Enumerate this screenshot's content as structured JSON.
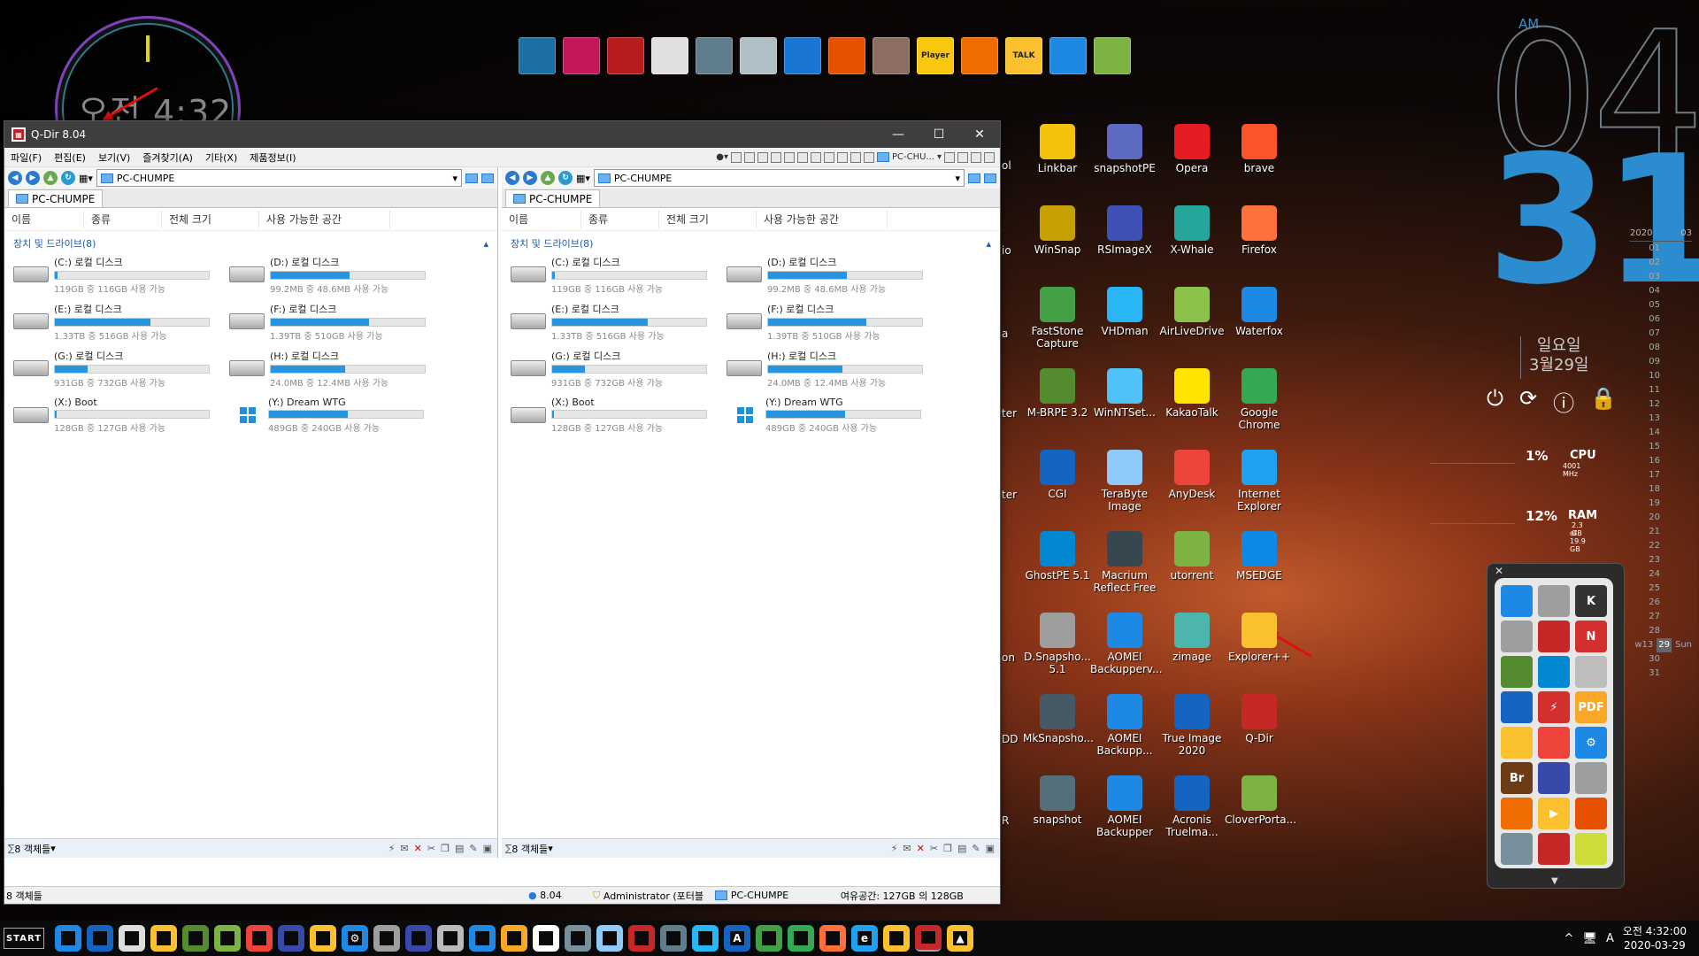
{
  "window": {
    "title": "Q-Dir 8.04",
    "minimize": "—",
    "maximize": "☐",
    "close": "✕"
  },
  "clock_widget": {
    "text": "오전 4:32"
  },
  "menu": [
    "파일(F)",
    "편집(E)",
    "보기(V)",
    "즐겨찾기(A)",
    "기타(X)",
    "제품정보(I)"
  ],
  "toolbar_pc": "PC-CHU...",
  "panes": [
    {
      "address": "PC-CHUMPE",
      "tab": "PC-CHUMPE",
      "columns": [
        "이름",
        "종류",
        "전체 크기",
        "사용 가능한 공간"
      ],
      "group": "장치 및 드라이브(8)",
      "status": "8 객체들",
      "drives": [
        {
          "name": "(C:) 로컬 디스크",
          "free": "119GB 중 116GB 사용 가능",
          "usage": 0.02,
          "win": false
        },
        {
          "name": "(D:) 로컬 디스크",
          "free": "99.2MB 중 48.6MB 사용 가능",
          "usage": 0.51,
          "win": false
        },
        {
          "name": "(E:) 로컬 디스크",
          "free": "1.33TB 중 516GB 사용 가능",
          "usage": 0.62,
          "win": false
        },
        {
          "name": "(F:) 로컬 디스크",
          "free": "1.39TB 중 510GB 사용 가능",
          "usage": 0.64,
          "win": false
        },
        {
          "name": "(G:) 로컬 디스크",
          "free": "931GB 중 732GB 사용 가능",
          "usage": 0.21,
          "win": false
        },
        {
          "name": "(H:) 로컬 디스크",
          "free": "24.0MB 중 12.4MB 사용 가능",
          "usage": 0.48,
          "win": false
        },
        {
          "name": "(X:) Boot",
          "free": "128GB 중 127GB 사용 가능",
          "usage": 0.01,
          "win": false
        },
        {
          "name": "(Y:) Dream WTG",
          "free": "489GB 중 240GB 사용 가능",
          "usage": 0.51,
          "win": true
        }
      ]
    },
    {
      "address": "PC-CHUMPE",
      "tab": "PC-CHUMPE",
      "columns": [
        "이름",
        "종류",
        "전체 크기",
        "사용 가능한 공간"
      ],
      "group": "장치 및 드라이브(8)",
      "status": "8 객체들",
      "drives": [
        {
          "name": "(C:) 로컬 디스크",
          "free": "119GB 중 116GB 사용 가능",
          "usage": 0.02,
          "win": false
        },
        {
          "name": "(D:) 로컬 디스크",
          "free": "99.2MB 중 48.6MB 사용 가능",
          "usage": 0.51,
          "win": false
        },
        {
          "name": "(E:) 로컬 디스크",
          "free": "1.33TB 중 516GB 사용 가능",
          "usage": 0.62,
          "win": false
        },
        {
          "name": "(F:) 로컬 디스크",
          "free": "1.39TB 중 510GB 사용 가능",
          "usage": 0.64,
          "win": false
        },
        {
          "name": "(G:) 로컬 디스크",
          "free": "931GB 중 732GB 사용 가능",
          "usage": 0.21,
          "win": false
        },
        {
          "name": "(H:) 로컬 디스크",
          "free": "24.0MB 중 12.4MB 사용 가능",
          "usage": 0.48,
          "win": false
        },
        {
          "name": "(X:) Boot",
          "free": "128GB 중 127GB 사용 가능",
          "usage": 0.01,
          "win": false
        },
        {
          "name": "(Y:) Dream WTG",
          "free": "489GB 중 240GB 사용 가능",
          "usage": 0.51,
          "win": true
        }
      ]
    }
  ],
  "footer": {
    "left": "8 객체들",
    "version": "8.04",
    "user": "Administrator (포터블",
    "pc": "PC-CHUMPE",
    "space": "여유공간: 127GB 의 128GB"
  },
  "topdock": [
    {
      "label": "",
      "color": "#1d6fa5"
    },
    {
      "label": "",
      "color": "#c2185b"
    },
    {
      "label": "",
      "color": "#b71c1c"
    },
    {
      "label": "",
      "color": "#e0e0e0"
    },
    {
      "label": "",
      "color": "#607d8b"
    },
    {
      "label": "",
      "color": "#b0bec5"
    },
    {
      "label": "",
      "color": "#1976d2"
    },
    {
      "label": "",
      "color": "#e65100"
    },
    {
      "label": "",
      "color": "#8d6e63"
    },
    {
      "label": "Player",
      "color": "#f9c80e"
    },
    {
      "label": "",
      "color": "#ef6c00"
    },
    {
      "label": "TALK",
      "color": "#fbc02d"
    },
    {
      "label": "",
      "color": "#1e88e5"
    },
    {
      "label": "",
      "color": "#7cb342"
    }
  ],
  "bigclock": {
    "ampm": "AM",
    "hour": "04",
    "minute": "31",
    "dow": "일요일",
    "date": "3월29일"
  },
  "power_icons": [
    "⏻",
    "⟳",
    "ⓘ",
    "🔒"
  ],
  "calendar": {
    "year": "2020",
    "month": "03",
    "days": [
      "01",
      "02",
      "03",
      "04",
      "05",
      "06",
      "07",
      "08",
      "09",
      "10",
      "11",
      "12",
      "13",
      "14",
      "15",
      "16",
      "17",
      "18",
      "19",
      "20",
      "21",
      "22",
      "23",
      "24",
      "25",
      "26",
      "27",
      "28"
    ],
    "week": "w13",
    "today": "29",
    "today_label": "Sun",
    "after": [
      "30",
      "31"
    ]
  },
  "cpu": {
    "pct": "1%",
    "label": "CPU",
    "sub": "4001 MHz"
  },
  "ram": {
    "pct": "12%",
    "label": "RAM",
    "sub1": "2.3 GB",
    "sub2": "of 19.9 GB"
  },
  "edge_labels": [
    "ol",
    "io",
    "a",
    "ter",
    "ter",
    "",
    "on",
    "DD",
    "R"
  ],
  "desktop_icons": [
    {
      "label": "Linkbar",
      "color": "#f4c20d"
    },
    {
      "label": "snapshotPE",
      "color": "#5c6bc0"
    },
    {
      "label": "Opera",
      "color": "#e51c23"
    },
    {
      "label": "brave",
      "color": "#fb542b"
    },
    {
      "label": "WinSnap",
      "color": "#c6a000"
    },
    {
      "label": "RSImageX",
      "color": "#3f51b5"
    },
    {
      "label": "X-Whale",
      "color": "#26a69a"
    },
    {
      "label": "Firefox",
      "color": "#ff7139"
    },
    {
      "label": "FastStone Capture",
      "color": "#43a047"
    },
    {
      "label": "VHDman",
      "color": "#29b6f6"
    },
    {
      "label": "AirLiveDrive",
      "color": "#8bc34a"
    },
    {
      "label": "Waterfox",
      "color": "#1e88e5"
    },
    {
      "label": "M-BRPE 3.2",
      "color": "#558b2f"
    },
    {
      "label": "WinNTSet...",
      "color": "#4fc3f7"
    },
    {
      "label": "KakaoTalk",
      "color": "#fee500"
    },
    {
      "label": "Google Chrome",
      "color": "#34a853"
    },
    {
      "label": "CGI",
      "color": "#1565c0"
    },
    {
      "label": "TeraByte Image",
      "color": "#90caf9"
    },
    {
      "label": "AnyDesk",
      "color": "#ef443b"
    },
    {
      "label": "Internet Explorer",
      "color": "#1ea1f1"
    },
    {
      "label": "GhostPE 5.1",
      "color": "#0288d1"
    },
    {
      "label": "Macrium Reflect Free",
      "color": "#37474f"
    },
    {
      "label": "utorrent",
      "color": "#7cb342"
    },
    {
      "label": "MSEDGE",
      "color": "#0c8ae5"
    },
    {
      "label": "D.Snapsho... 5.1",
      "color": "#9e9e9e"
    },
    {
      "label": "AOMEI Backupperv...",
      "color": "#1e88e5"
    },
    {
      "label": "zimage",
      "color": "#4db6ac"
    },
    {
      "label": "Explorer++",
      "color": "#fbc02d"
    },
    {
      "label": "MkSnapsho...",
      "color": "#455a64"
    },
    {
      "label": "AOMEI Backupp...",
      "color": "#1e88e5"
    },
    {
      "label": "True Image 2020",
      "color": "#1565c0"
    },
    {
      "label": "Q-Dir",
      "color": "#c62828"
    },
    {
      "label": "snapshot",
      "color": "#546e7a"
    },
    {
      "label": "AOMEI Backupper",
      "color": "#1e88e5"
    },
    {
      "label": "Acronis Truelma...",
      "color": "#1565c0"
    },
    {
      "label": "CloverPorta...",
      "color": "#7cb342"
    }
  ],
  "side_panel": {
    "close": "✕",
    "icons": [
      {
        "color": "#1e88e5",
        "label": ""
      },
      {
        "color": "#9e9e9e",
        "label": ""
      },
      {
        "color": "#333",
        "label": "K"
      },
      {
        "color": "#9e9e9e",
        "label": ""
      },
      {
        "color": "#c62828",
        "label": ""
      },
      {
        "color": "#d32f2f",
        "label": "N"
      },
      {
        "color": "#558b2f",
        "label": ""
      },
      {
        "color": "#0288d1",
        "label": ""
      },
      {
        "color": "#bdbdbd",
        "label": ""
      },
      {
        "color": "#1565c0",
        "label": ""
      },
      {
        "color": "#d32f2f",
        "label": "⚡"
      },
      {
        "color": "#f9a825",
        "label": "PDF"
      },
      {
        "color": "#fbc02d",
        "label": ""
      },
      {
        "color": "#ef443b",
        "label": ""
      },
      {
        "color": "#1e88e5",
        "label": "⚙"
      },
      {
        "color": "#6d3b16",
        "label": "Br"
      },
      {
        "color": "#3949ab",
        "label": ""
      },
      {
        "color": "#9e9e9e",
        "label": ""
      },
      {
        "color": "#ef6c00",
        "label": ""
      },
      {
        "color": "#fbc02d",
        "label": "▶"
      },
      {
        "color": "#e65100",
        "label": ""
      },
      {
        "color": "#78909c",
        "label": ""
      },
      {
        "color": "#c62828",
        "label": ""
      },
      {
        "color": "#cddc39",
        "label": ""
      }
    ]
  },
  "taskbar": {
    "start": "START",
    "icons": [
      {
        "color": "#1e88e5",
        "label": ""
      },
      {
        "color": "#1565c0",
        "label": ""
      },
      {
        "color": "#ddd",
        "label": ""
      },
      {
        "color": "#fbc02d",
        "label": ""
      },
      {
        "color": "#558b2f",
        "label": ""
      },
      {
        "color": "#7cb342",
        "label": ""
      },
      {
        "color": "#ef443b",
        "label": ""
      },
      {
        "color": "#3949ab",
        "label": ""
      },
      {
        "color": "#fbc02d",
        "label": ""
      },
      {
        "color": "#1e88e5",
        "label": "⚙"
      },
      {
        "color": "#9e9e9e",
        "label": ""
      },
      {
        "color": "#3949ab",
        "label": ""
      },
      {
        "color": "#bbb",
        "label": ""
      },
      {
        "color": "#1e88e5",
        "label": ""
      },
      {
        "color": "#f9a825",
        "label": ""
      },
      {
        "color": "#fff",
        "label": ""
      },
      {
        "color": "#78909c",
        "label": ""
      },
      {
        "color": "#90caf9",
        "label": ""
      },
      {
        "color": "#c62828",
        "label": ""
      },
      {
        "color": "#607d8b",
        "label": ""
      },
      {
        "color": "#29b6f6",
        "label": ""
      },
      {
        "color": "#1565c0",
        "label": "A"
      },
      {
        "color": "#43a047",
        "label": ""
      },
      {
        "color": "#34a853",
        "label": ""
      },
      {
        "color": "#ff7139",
        "label": ""
      },
      {
        "color": "#1ea1f1",
        "label": "e"
      },
      {
        "color": "#fbc02d",
        "label": ""
      },
      {
        "color": "#c62828",
        "label": "",
        "active": true
      },
      {
        "color": "#fbc02d",
        "label": "▲"
      }
    ]
  },
  "tray": {
    "chevron": "^",
    "network": "🖥",
    "ime": "A",
    "time": "오전 4:32:00",
    "date": "2020-03-29"
  }
}
